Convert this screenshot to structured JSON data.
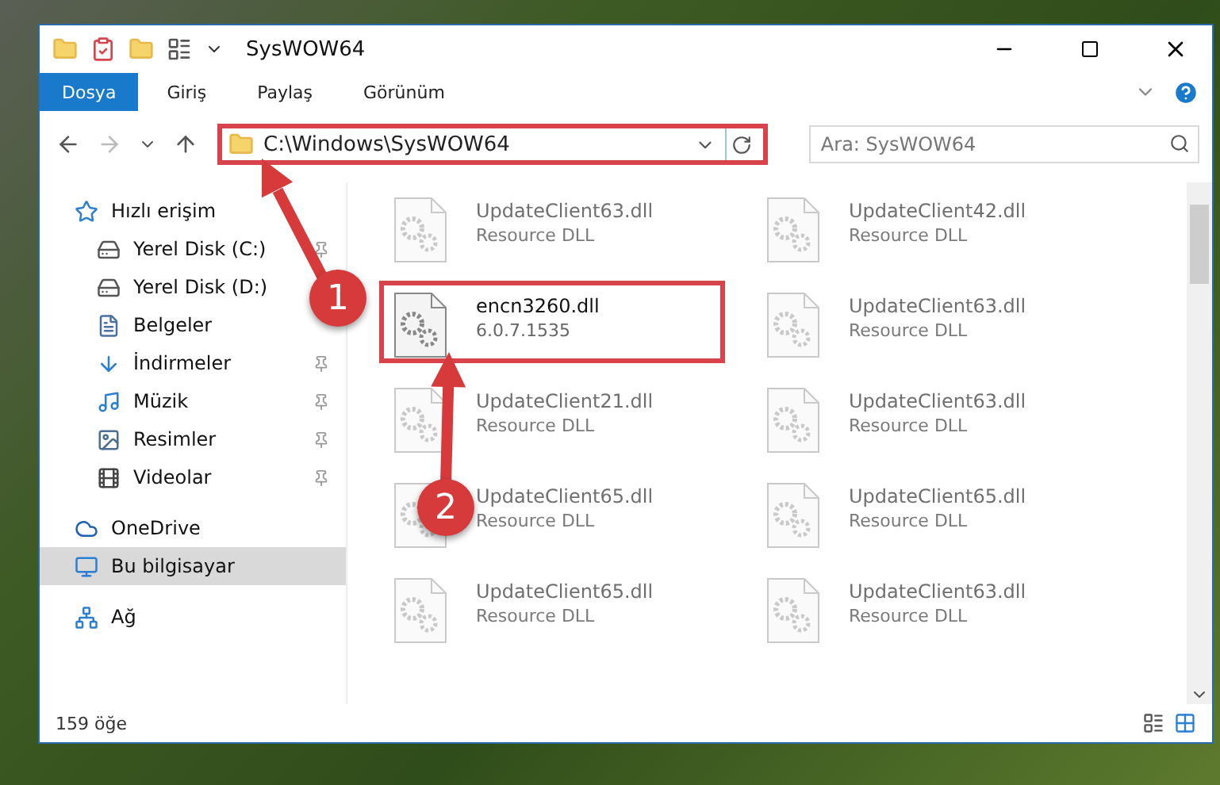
{
  "window": {
    "title": "SysWOW64"
  },
  "ribbon_tabs": [
    {
      "label": "Dosya",
      "selected": true
    },
    {
      "label": "Giriş",
      "selected": false
    },
    {
      "label": "Paylaş",
      "selected": false
    },
    {
      "label": "Görünüm",
      "selected": false
    }
  ],
  "address": {
    "path": "C:\\Windows\\SysWOW64",
    "highlighted": true
  },
  "search": {
    "placeholder": "Ara: SysWOW64"
  },
  "sidebar": {
    "items": [
      {
        "label": "Hızlı erişim",
        "kind": "star",
        "selected": false,
        "children": [
          {
            "label": "Yerel Disk (C:)",
            "kind": "drive-windows",
            "pinned": true
          },
          {
            "label": "Yerel Disk (D:)",
            "kind": "drive",
            "pinned": false
          },
          {
            "label": "Belgeler",
            "kind": "document",
            "pinned": false
          },
          {
            "label": "İndirmeler",
            "kind": "download",
            "pinned": true
          },
          {
            "label": "Müzik",
            "kind": "music",
            "pinned": true
          },
          {
            "label": "Resimler",
            "kind": "picture",
            "pinned": true
          },
          {
            "label": "Videolar",
            "kind": "video",
            "pinned": true
          }
        ]
      },
      {
        "label": "OneDrive",
        "kind": "cloud",
        "selected": false
      },
      {
        "label": "Bu bilgisayar",
        "kind": "computer",
        "selected": true
      },
      {
        "label": "Ağ",
        "kind": "network",
        "selected": false
      }
    ]
  },
  "files": [
    {
      "name": "UpdateClient63.dll",
      "type": "Resource DLL",
      "blurred": true,
      "highlighted": false
    },
    {
      "name": "UpdateClient42.dll",
      "type": "Resource DLL",
      "blurred": true,
      "highlighted": false
    },
    {
      "name": "encn3260.dll",
      "type": "6.0.7.1535",
      "blurred": false,
      "highlighted": true
    },
    {
      "name": "UpdateClient63.dll",
      "type": "Resource DLL",
      "blurred": true,
      "highlighted": false
    },
    {
      "name": "UpdateClient21.dll",
      "type": "Resource DLL",
      "blurred": true,
      "highlighted": false
    },
    {
      "name": "UpdateClient63.dll",
      "type": "Resource DLL",
      "blurred": true,
      "highlighted": false
    },
    {
      "name": "UpdateClient65.dll",
      "type": "Resource DLL",
      "blurred": true,
      "highlighted": false
    },
    {
      "name": "UpdateClient65.dll",
      "type": "Resource DLL",
      "blurred": true,
      "highlighted": false
    },
    {
      "name": "UpdateClient65.dll",
      "type": "Resource DLL",
      "blurred": true,
      "highlighted": false
    },
    {
      "name": "UpdateClient63.dll",
      "type": "Resource DLL",
      "blurred": true,
      "highlighted": false
    }
  ],
  "annotations": [
    {
      "number": "1"
    },
    {
      "number": "2"
    }
  ],
  "status_bar": {
    "count": "159 öğe"
  }
}
